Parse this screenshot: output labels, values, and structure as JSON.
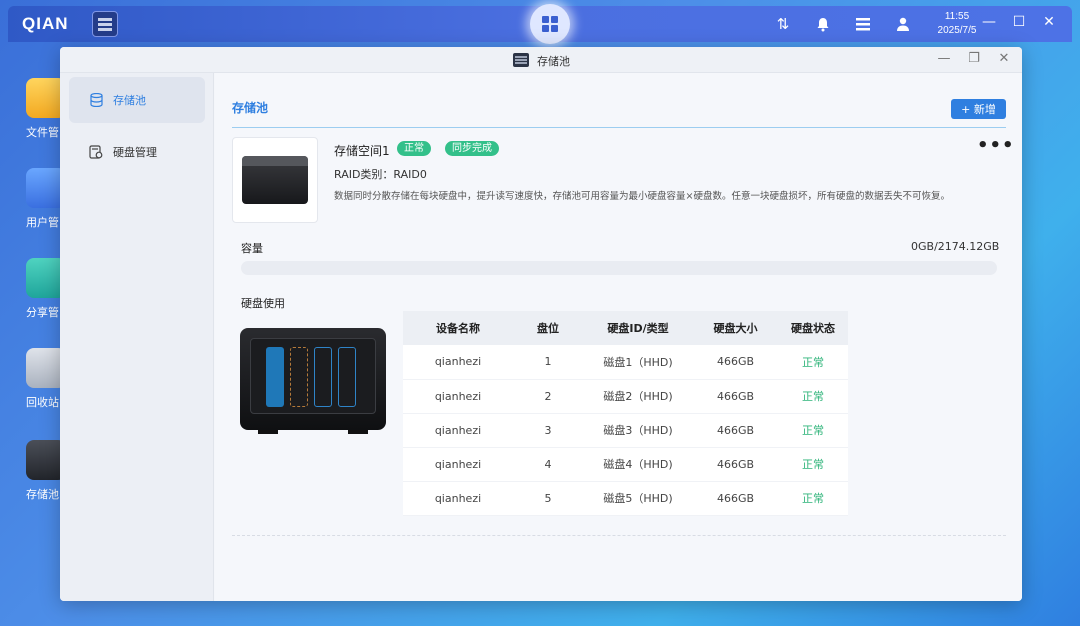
{
  "taskbar": {
    "logo": "QIAN",
    "clock_time": "11:55",
    "clock_date": "2025/7/5",
    "icons": [
      "transfer-icon",
      "bell-icon",
      "menu-list-icon",
      "user-icon",
      "minimize-icon",
      "maximize-icon",
      "close-icon"
    ]
  },
  "desktop": {
    "icons": [
      {
        "label": "文件管",
        "icon": "folder-icon"
      },
      {
        "label": "用户管",
        "icon": "users-icon"
      },
      {
        "label": "分享管",
        "icon": "share-icon"
      },
      {
        "label": "回收站",
        "icon": "recycle-bin-icon"
      },
      {
        "label": "存储池",
        "icon": "storage-pool-icon"
      }
    ]
  },
  "window": {
    "title": "存储池",
    "sidebar": {
      "items": [
        {
          "label": "存储池",
          "icon": "database-icon",
          "active": true
        },
        {
          "label": "硬盘管理",
          "icon": "disk-settings-icon",
          "active": false
        }
      ]
    },
    "main": {
      "page_title": "存储池",
      "add_button": "+ 新增",
      "pool": {
        "name": "存储空间1",
        "status_badge": "正常",
        "sync_badge": "同步完成",
        "raid_line": "RAID类别：RAID0",
        "description": "数据同时分散存储在每块硬盘中，提升读写速度快，存储池可用容量为最小硬盘容量×硬盘数。任意一块硬盘损坏，所有硬盘的数据丢失不可恢复。",
        "more_label": "•••"
      },
      "capacity": {
        "label": "容量",
        "value": "0GB/2174.12GB",
        "used_fraction": 0.0
      },
      "disk_usage": {
        "label": "硬盘使用",
        "columns": [
          "设备名称",
          "盘位",
          "硬盘ID/类型",
          "硬盘大小",
          "硬盘状态"
        ],
        "rows": [
          [
            "qianhezi",
            "1",
            "磁盘1（HHD)",
            "466GB",
            "正常"
          ],
          [
            "qianhezi",
            "2",
            "磁盘2（HHD)",
            "466GB",
            "正常"
          ],
          [
            "qianhezi",
            "3",
            "磁盘3（HHD)",
            "466GB",
            "正常"
          ],
          [
            "qianhezi",
            "4",
            "磁盘4（HHD)",
            "466GB",
            "正常"
          ],
          [
            "qianhezi",
            "5",
            "磁盘5（HHD)",
            "466GB",
            "正常"
          ]
        ]
      }
    }
  },
  "colors": {
    "accent": "#2f7fe0",
    "status_green": "#33c08a"
  }
}
